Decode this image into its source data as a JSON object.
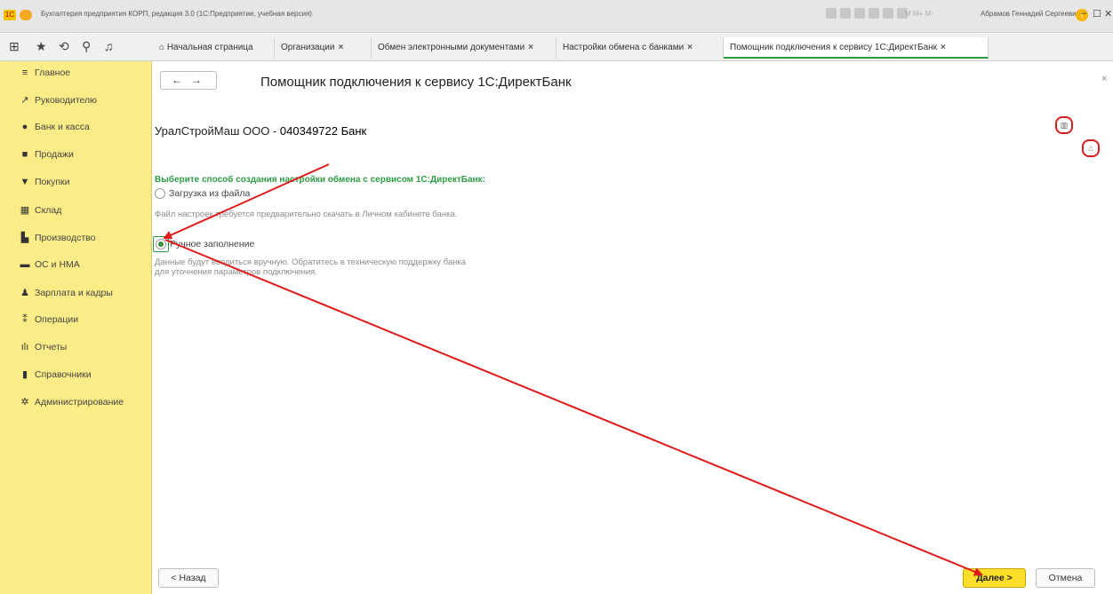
{
  "app": {
    "title": "Бухгалтерия предприятия КОРП, редакция 3.0  (1С:Предприятие, учебная версия)",
    "memory_indicators": "M  M+  M-",
    "user": "Абрамов Геннадий Сергеевич",
    "window_buttons": [
      "–",
      "☐",
      "✕"
    ]
  },
  "tabs": [
    {
      "label": "Начальная страница",
      "closable": false
    },
    {
      "label": "Организации",
      "closable": true
    },
    {
      "label": "Обмен электронными документами",
      "closable": true
    },
    {
      "label": "Настройки обмена с банками",
      "closable": true
    },
    {
      "label": "Помощник подключения к сервису 1С:ДиректБанк",
      "closable": true,
      "active": true
    }
  ],
  "sidebar": {
    "items": [
      {
        "label": "Главное",
        "icon": "menu-icon"
      },
      {
        "label": "Руководителю",
        "icon": "chart-line-icon"
      },
      {
        "label": "Банк и касса",
        "icon": "coins-icon"
      },
      {
        "label": "Продажи",
        "icon": "shopping-bag-icon"
      },
      {
        "label": "Покупки",
        "icon": "cart-icon"
      },
      {
        "label": "Склад",
        "icon": "warehouse-icon"
      },
      {
        "label": "Производство",
        "icon": "factory-icon"
      },
      {
        "label": "ОС и НМА",
        "icon": "truck-icon"
      },
      {
        "label": "Зарплата и кадры",
        "icon": "person-icon"
      },
      {
        "label": "Операции",
        "icon": "operations-icon"
      },
      {
        "label": "Отчеты",
        "icon": "bar-chart-icon"
      },
      {
        "label": "Справочники",
        "icon": "book-icon"
      },
      {
        "label": "Администрирование",
        "icon": "gear-icon"
      }
    ]
  },
  "form": {
    "title": "Помощник подключения к сервису 1С:ДиректБанк",
    "org_prefix": "УралСтройМаш ООО - ",
    "org_bank": "040349722 Банк",
    "question": "Выберите способ создания настройки обмена с сервисом 1С:ДиректБанк:",
    "option_file": {
      "label": "Загрузка из файла",
      "hint": "Файл настроек требуется предварительно скачать в Личном кабинете банка.",
      "selected": false
    },
    "option_manual": {
      "label": "Ручное заполнение",
      "hint": "Данные будут вводиться вручную. Обратитесь в техническую поддержку банка для уточнения параметров подключения.",
      "selected": true
    },
    "back_label": "< Назад",
    "next_label": "Далее >",
    "cancel_label": "Отмена"
  },
  "colors": {
    "sidebar_bg": "#fbec88",
    "accent_green": "#2e9c44",
    "primary_button": "#ffde2a",
    "annotation_red": "#e01b1b"
  }
}
